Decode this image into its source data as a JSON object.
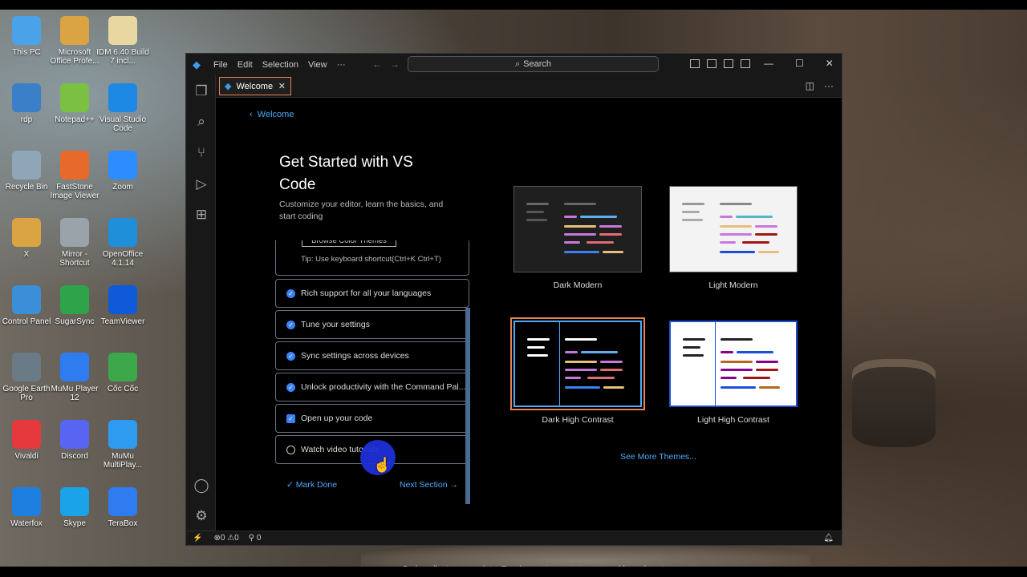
{
  "desktop": {
    "icons": [
      {
        "label": "This PC",
        "icon": "computer-icon",
        "color": "#4aa3e8"
      },
      {
        "label": "Microsoft Office Profe...",
        "icon": "office-folder-icon",
        "color": "#d9a441"
      },
      {
        "label": "IDM 6.40 Build 7 incl...",
        "icon": "archive-icon",
        "color": "#e8d7a0"
      },
      {
        "label": "rdp",
        "icon": "remote-desktop-icon",
        "color": "#3a7fc8"
      },
      {
        "label": "Notepad++",
        "icon": "notepad-icon",
        "color": "#7bc043"
      },
      {
        "label": "Visual Studio Code",
        "icon": "vscode-icon",
        "color": "#1e88e5"
      },
      {
        "label": "Recycle Bin",
        "icon": "recycle-bin-icon",
        "color": "#8fa6b8"
      },
      {
        "label": "FastStone Image Viewer",
        "icon": "eye-icon",
        "color": "#e86a2a"
      },
      {
        "label": "Zoom",
        "icon": "zoom-icon",
        "color": "#2d8cff"
      },
      {
        "label": "X",
        "icon": "user-folder-icon",
        "color": "#d9a441"
      },
      {
        "label": "Mirror - Shortcut",
        "icon": "settings-window-icon",
        "color": "#9aa3aa"
      },
      {
        "label": "OpenOffice 4.1.14",
        "icon": "openoffice-icon",
        "color": "#1e8fd8"
      },
      {
        "label": "Control Panel",
        "icon": "control-panel-icon",
        "color": "#3a8fd8"
      },
      {
        "label": "SugarSync",
        "icon": "hummingbird-icon",
        "color": "#2fa34a"
      },
      {
        "label": "TeamViewer",
        "icon": "teamviewer-icon",
        "color": "#0e5ad8"
      },
      {
        "label": "Google Earth Pro",
        "icon": "globe-icon",
        "color": "#6a7a86"
      },
      {
        "label": "MuMu Player 12",
        "icon": "mumu-icon",
        "color": "#2f7bf0"
      },
      {
        "label": "Cốc Cốc",
        "icon": "coccoc-icon",
        "color": "#3ca84a"
      },
      {
        "label": "Vivaldi",
        "icon": "vivaldi-icon",
        "color": "#e5393d"
      },
      {
        "label": "Discord",
        "icon": "discord-icon",
        "color": "#5865f2"
      },
      {
        "label": "MuMu MultiPlay...",
        "icon": "mumu-multi-icon",
        "color": "#2f9bf0"
      },
      {
        "label": "Waterfox",
        "icon": "waterfox-icon",
        "color": "#1f7fe0"
      },
      {
        "label": "Skype",
        "icon": "skype-icon",
        "color": "#1aa3e8"
      },
      {
        "label": "TeraBox",
        "icon": "terabox-icon",
        "color": "#2f7bf0"
      }
    ]
  },
  "window": {
    "menu": [
      "File",
      "Edit",
      "Selection",
      "View",
      "···"
    ],
    "search_label": "Search",
    "tab_label": "Welcome"
  },
  "welcome": {
    "back_label": "Welcome",
    "title": "Get Started with VS Code",
    "subtitle": "Customize your editor, learn the basics, and start coding",
    "partial_button": "Browse Color Themes",
    "tip": "Tip: Use keyboard shortcut(Ctrl+K Ctrl+T)",
    "steps": [
      {
        "label": "Rich support for all your languages",
        "state": "done"
      },
      {
        "label": "Tune your settings",
        "state": "done"
      },
      {
        "label": "Sync settings across devices",
        "state": "done"
      },
      {
        "label": "Unlock productivity with the Command Pal...",
        "state": "done"
      },
      {
        "label": "Open up your code",
        "state": "done-box"
      },
      {
        "label": "Watch video tutorials",
        "state": "open"
      }
    ],
    "mark_done": "Mark Done",
    "next_section": "Next Section",
    "themes": [
      {
        "label": "Dark Modern",
        "bg": "#1f1f1f",
        "selected": false
      },
      {
        "label": "Light Modern",
        "bg": "#f3f3f3",
        "selected": false
      },
      {
        "label": "Dark High Contrast",
        "bg": "#000000",
        "selected": true
      },
      {
        "label": "Light High Contrast",
        "bg": "#ffffff",
        "selected": false
      }
    ],
    "see_more": "See More Themes...",
    "footer_prefix": "Code collects usage data. Read our",
    "footer_link1": "privacy statement",
    "footer_mid": "and learn how to",
    "footer_link2": "opt out",
    "footer_suffix": "."
  },
  "status": {
    "errors": "0",
    "warnings": "0",
    "ports": "0"
  },
  "colors": {
    "accent": "#4daafc",
    "tab_focus": "#e9824f",
    "check": "#3b82f6"
  }
}
